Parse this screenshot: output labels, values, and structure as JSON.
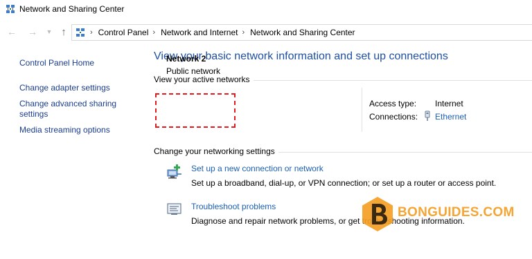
{
  "window": {
    "title": "Network and Sharing Center"
  },
  "navigation": {
    "back_icon": "back-arrow-icon",
    "forward_icon": "forward-arrow-icon",
    "recent_icon": "chevron-down-icon",
    "up_icon": "up-arrow-icon",
    "breadcrumbs": [
      "Control Panel",
      "Network and Internet",
      "Network and Sharing Center"
    ]
  },
  "left_nav": {
    "home": "Control Panel Home",
    "adapter": "Change adapter settings",
    "advanced": "Change advanced sharing settings",
    "media": "Media streaming options"
  },
  "main": {
    "heading": "View your basic network information and set up connections",
    "active_networks_label": "View your active networks",
    "network": {
      "name": "Network 2",
      "category": "Public network",
      "access_type_label": "Access type:",
      "access_type_value": "Internet",
      "connections_label": "Connections:",
      "connections_value": "Ethernet"
    },
    "change_settings_label": "Change your networking settings",
    "tasks": [
      {
        "link": "Set up a new connection or network",
        "description": "Set up a broadband, dial-up, or VPN connection; or set up a router or access point.",
        "icon": "new-connection-icon"
      },
      {
        "link": "Troubleshoot problems",
        "description": "Diagnose and repair network problems, or get troubleshooting information.",
        "icon": "troubleshoot-icon"
      }
    ]
  },
  "watermark": {
    "text": "BONGUIDES.COM"
  },
  "colors": {
    "link": "#1a5fb4",
    "heading": "#1e4fa3",
    "highlight_box": "#e3191b",
    "watermark": "#f59e23"
  }
}
